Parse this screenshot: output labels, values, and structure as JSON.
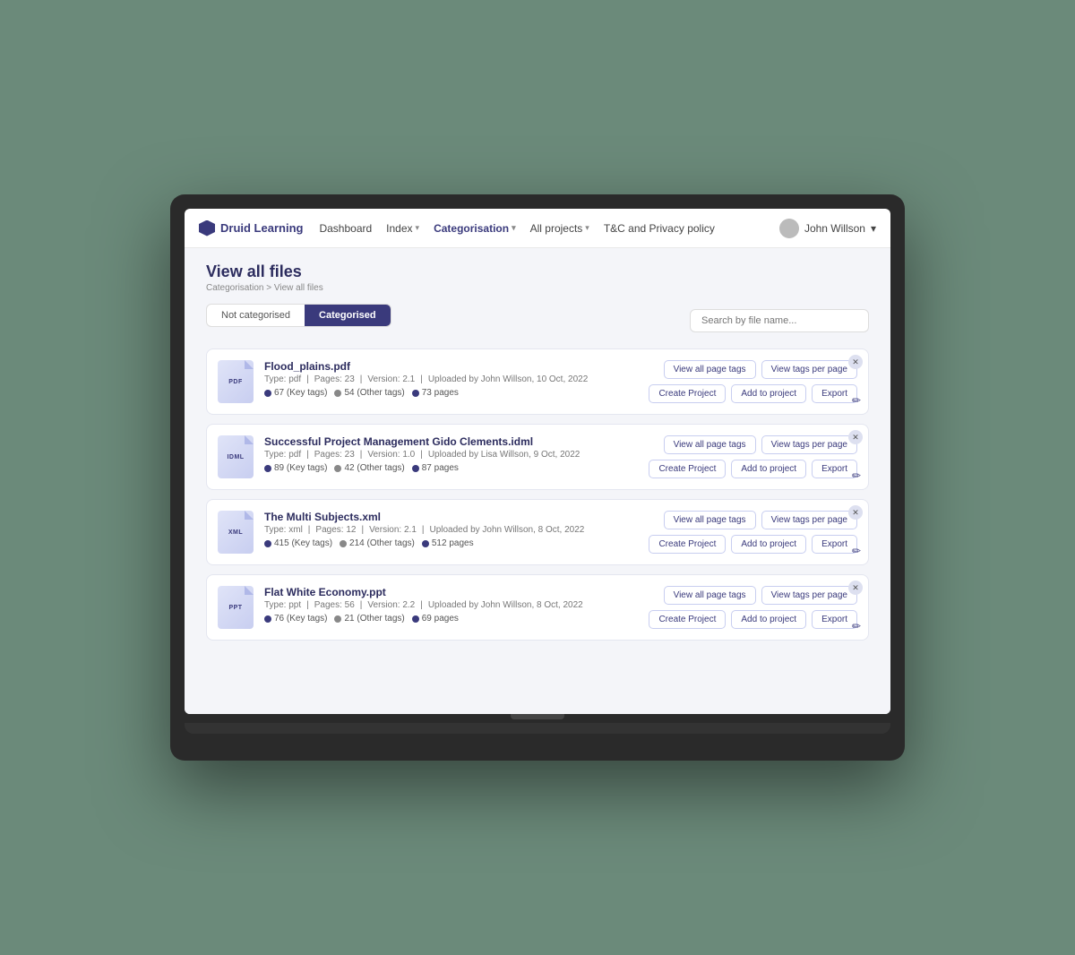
{
  "nav": {
    "logo": "Druid Learning",
    "items": [
      {
        "label": "Dashboard",
        "active": false,
        "hasDropdown": false
      },
      {
        "label": "Index",
        "active": false,
        "hasDropdown": true
      },
      {
        "label": "Categorisation",
        "active": true,
        "hasDropdown": true
      },
      {
        "label": "All projects",
        "active": false,
        "hasDropdown": true
      },
      {
        "label": "T&C and Privacy policy",
        "active": false,
        "hasDropdown": false
      }
    ],
    "user": "John Willson"
  },
  "page": {
    "title": "View all files",
    "breadcrumb": "Categorisation > View all files"
  },
  "tabs": [
    {
      "label": "Not categorised",
      "active": false
    },
    {
      "label": "Categorised",
      "active": true
    }
  ],
  "search": {
    "placeholder": "Search by file name..."
  },
  "files": [
    {
      "name": "Flood_plains.pdf",
      "ext": "PDF",
      "type": "pdf",
      "pages": 23,
      "version": "2.1",
      "uploaded_by": "John Willson",
      "uploaded_date": "10 Oct, 2022",
      "key_tags": 67,
      "other_tags": 54,
      "total_pages": 73
    },
    {
      "name": "Successful Project Management Gido Clements.idml",
      "ext": "IDML",
      "type": "pdf",
      "pages": 23,
      "version": "1.0",
      "uploaded_by": "Lisa Willson",
      "uploaded_date": "9 Oct, 2022",
      "key_tags": 89,
      "other_tags": 42,
      "total_pages": 87
    },
    {
      "name": "The Multi Subjects.xml",
      "ext": "XML",
      "type": "xml",
      "pages": 12,
      "version": "2.1",
      "uploaded_by": "John Willson",
      "uploaded_date": "8 Oct, 2022",
      "key_tags": 415,
      "other_tags": 214,
      "total_pages": 512
    },
    {
      "name": "Flat White Economy.ppt",
      "ext": "PPT",
      "type": "ppt",
      "pages": 56,
      "version": "2.2",
      "uploaded_by": "John Willson",
      "uploaded_date": "8 Oct, 2022",
      "key_tags": 76,
      "other_tags": 21,
      "total_pages": 69
    }
  ],
  "actions": {
    "view_all_page_tags": "View all page tags",
    "view_tags_per_page": "View tags per page",
    "create_project": "Create Project",
    "add_to_project": "Add to project",
    "export": "Export"
  }
}
